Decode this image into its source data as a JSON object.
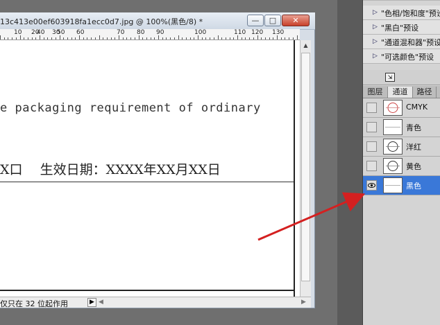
{
  "document": {
    "title": "13c413e00ef603918fa1ecc0d7.jpg @ 100%(黑色/8) *",
    "ruler_labels": [
      "10",
      "20",
      "30",
      "40",
      "50",
      "60",
      "70",
      "80",
      "90",
      "100",
      "110",
      "120",
      "130"
    ],
    "text_line1": "e packaging requirement of ordinary",
    "text_line2": "X口　 生效日期：XXXX年XX月XX日",
    "status_text": "仅只在 32 位起作用"
  },
  "window_buttons": {
    "minimize": "—",
    "maximize": "□",
    "close": "✕"
  },
  "adjustments": {
    "items": [
      "\"色相/饱和度\"预设",
      "\"黑白\"预设",
      "\"通道混和器\"预设",
      "\"可选颜色\"预设"
    ]
  },
  "panel": {
    "tabs": [
      "图层",
      "通道",
      "路径"
    ],
    "active_tab": "通道",
    "channels": [
      {
        "name": "CMYK",
        "visible": false,
        "selected": false
      },
      {
        "name": "青色",
        "visible": false,
        "selected": false
      },
      {
        "name": "洋红",
        "visible": false,
        "selected": false
      },
      {
        "name": "黄色",
        "visible": false,
        "selected": false
      },
      {
        "name": "黑色",
        "visible": true,
        "selected": true
      }
    ]
  },
  "colors": {
    "selection": "#3a78d8",
    "annotation_arrow": "#d42020"
  }
}
